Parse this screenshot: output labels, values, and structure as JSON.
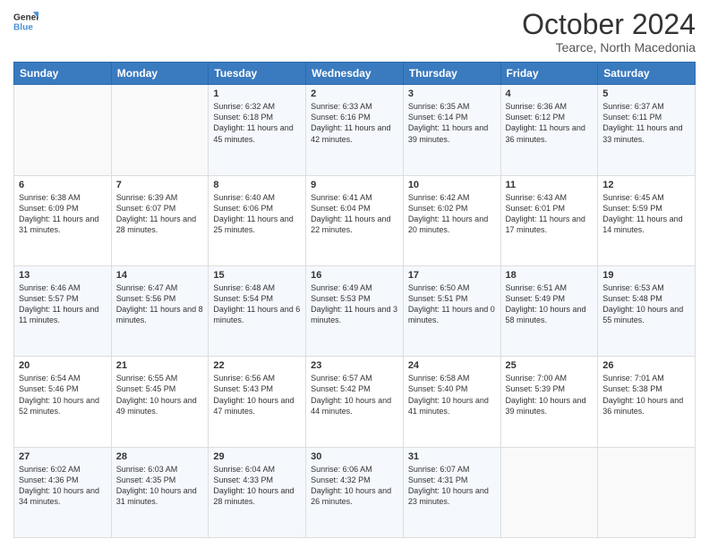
{
  "logo": {
    "line1": "General",
    "line2": "Blue"
  },
  "title": "October 2024",
  "location": "Tearce, North Macedonia",
  "days_header": [
    "Sunday",
    "Monday",
    "Tuesday",
    "Wednesday",
    "Thursday",
    "Friday",
    "Saturday"
  ],
  "weeks": [
    [
      {
        "num": "",
        "sunrise": "",
        "sunset": "",
        "daylight": ""
      },
      {
        "num": "",
        "sunrise": "",
        "sunset": "",
        "daylight": ""
      },
      {
        "num": "1",
        "sunrise": "Sunrise: 6:32 AM",
        "sunset": "Sunset: 6:18 PM",
        "daylight": "Daylight: 11 hours and 45 minutes."
      },
      {
        "num": "2",
        "sunrise": "Sunrise: 6:33 AM",
        "sunset": "Sunset: 6:16 PM",
        "daylight": "Daylight: 11 hours and 42 minutes."
      },
      {
        "num": "3",
        "sunrise": "Sunrise: 6:35 AM",
        "sunset": "Sunset: 6:14 PM",
        "daylight": "Daylight: 11 hours and 39 minutes."
      },
      {
        "num": "4",
        "sunrise": "Sunrise: 6:36 AM",
        "sunset": "Sunset: 6:12 PM",
        "daylight": "Daylight: 11 hours and 36 minutes."
      },
      {
        "num": "5",
        "sunrise": "Sunrise: 6:37 AM",
        "sunset": "Sunset: 6:11 PM",
        "daylight": "Daylight: 11 hours and 33 minutes."
      }
    ],
    [
      {
        "num": "6",
        "sunrise": "Sunrise: 6:38 AM",
        "sunset": "Sunset: 6:09 PM",
        "daylight": "Daylight: 11 hours and 31 minutes."
      },
      {
        "num": "7",
        "sunrise": "Sunrise: 6:39 AM",
        "sunset": "Sunset: 6:07 PM",
        "daylight": "Daylight: 11 hours and 28 minutes."
      },
      {
        "num": "8",
        "sunrise": "Sunrise: 6:40 AM",
        "sunset": "Sunset: 6:06 PM",
        "daylight": "Daylight: 11 hours and 25 minutes."
      },
      {
        "num": "9",
        "sunrise": "Sunrise: 6:41 AM",
        "sunset": "Sunset: 6:04 PM",
        "daylight": "Daylight: 11 hours and 22 minutes."
      },
      {
        "num": "10",
        "sunrise": "Sunrise: 6:42 AM",
        "sunset": "Sunset: 6:02 PM",
        "daylight": "Daylight: 11 hours and 20 minutes."
      },
      {
        "num": "11",
        "sunrise": "Sunrise: 6:43 AM",
        "sunset": "Sunset: 6:01 PM",
        "daylight": "Daylight: 11 hours and 17 minutes."
      },
      {
        "num": "12",
        "sunrise": "Sunrise: 6:45 AM",
        "sunset": "Sunset: 5:59 PM",
        "daylight": "Daylight: 11 hours and 14 minutes."
      }
    ],
    [
      {
        "num": "13",
        "sunrise": "Sunrise: 6:46 AM",
        "sunset": "Sunset: 5:57 PM",
        "daylight": "Daylight: 11 hours and 11 minutes."
      },
      {
        "num": "14",
        "sunrise": "Sunrise: 6:47 AM",
        "sunset": "Sunset: 5:56 PM",
        "daylight": "Daylight: 11 hours and 8 minutes."
      },
      {
        "num": "15",
        "sunrise": "Sunrise: 6:48 AM",
        "sunset": "Sunset: 5:54 PM",
        "daylight": "Daylight: 11 hours and 6 minutes."
      },
      {
        "num": "16",
        "sunrise": "Sunrise: 6:49 AM",
        "sunset": "Sunset: 5:53 PM",
        "daylight": "Daylight: 11 hours and 3 minutes."
      },
      {
        "num": "17",
        "sunrise": "Sunrise: 6:50 AM",
        "sunset": "Sunset: 5:51 PM",
        "daylight": "Daylight: 11 hours and 0 minutes."
      },
      {
        "num": "18",
        "sunrise": "Sunrise: 6:51 AM",
        "sunset": "Sunset: 5:49 PM",
        "daylight": "Daylight: 10 hours and 58 minutes."
      },
      {
        "num": "19",
        "sunrise": "Sunrise: 6:53 AM",
        "sunset": "Sunset: 5:48 PM",
        "daylight": "Daylight: 10 hours and 55 minutes."
      }
    ],
    [
      {
        "num": "20",
        "sunrise": "Sunrise: 6:54 AM",
        "sunset": "Sunset: 5:46 PM",
        "daylight": "Daylight: 10 hours and 52 minutes."
      },
      {
        "num": "21",
        "sunrise": "Sunrise: 6:55 AM",
        "sunset": "Sunset: 5:45 PM",
        "daylight": "Daylight: 10 hours and 49 minutes."
      },
      {
        "num": "22",
        "sunrise": "Sunrise: 6:56 AM",
        "sunset": "Sunset: 5:43 PM",
        "daylight": "Daylight: 10 hours and 47 minutes."
      },
      {
        "num": "23",
        "sunrise": "Sunrise: 6:57 AM",
        "sunset": "Sunset: 5:42 PM",
        "daylight": "Daylight: 10 hours and 44 minutes."
      },
      {
        "num": "24",
        "sunrise": "Sunrise: 6:58 AM",
        "sunset": "Sunset: 5:40 PM",
        "daylight": "Daylight: 10 hours and 41 minutes."
      },
      {
        "num": "25",
        "sunrise": "Sunrise: 7:00 AM",
        "sunset": "Sunset: 5:39 PM",
        "daylight": "Daylight: 10 hours and 39 minutes."
      },
      {
        "num": "26",
        "sunrise": "Sunrise: 7:01 AM",
        "sunset": "Sunset: 5:38 PM",
        "daylight": "Daylight: 10 hours and 36 minutes."
      }
    ],
    [
      {
        "num": "27",
        "sunrise": "Sunrise: 6:02 AM",
        "sunset": "Sunset: 4:36 PM",
        "daylight": "Daylight: 10 hours and 34 minutes."
      },
      {
        "num": "28",
        "sunrise": "Sunrise: 6:03 AM",
        "sunset": "Sunset: 4:35 PM",
        "daylight": "Daylight: 10 hours and 31 minutes."
      },
      {
        "num": "29",
        "sunrise": "Sunrise: 6:04 AM",
        "sunset": "Sunset: 4:33 PM",
        "daylight": "Daylight: 10 hours and 28 minutes."
      },
      {
        "num": "30",
        "sunrise": "Sunrise: 6:06 AM",
        "sunset": "Sunset: 4:32 PM",
        "daylight": "Daylight: 10 hours and 26 minutes."
      },
      {
        "num": "31",
        "sunrise": "Sunrise: 6:07 AM",
        "sunset": "Sunset: 4:31 PM",
        "daylight": "Daylight: 10 hours and 23 minutes."
      },
      {
        "num": "",
        "sunrise": "",
        "sunset": "",
        "daylight": ""
      },
      {
        "num": "",
        "sunrise": "",
        "sunset": "",
        "daylight": ""
      }
    ]
  ]
}
